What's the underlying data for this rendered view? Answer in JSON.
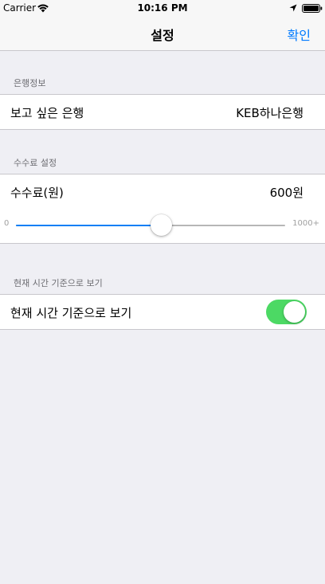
{
  "status_bar": {
    "carrier": "Carrier",
    "time": "10:16 PM",
    "icons": [
      "wifi-icon",
      "location-icon",
      "battery-icon"
    ]
  },
  "nav": {
    "title": "설정",
    "confirm_label": "확인"
  },
  "colors": {
    "accent": "#007aff",
    "slider_fill": "#0f7ff5",
    "toggle_on": "#4cd964",
    "background": "#efeff4"
  },
  "bank_section": {
    "header": "은행정보",
    "row_label": "보고 싶은 은행",
    "row_value": "KEB하나은행"
  },
  "fee_section": {
    "header": "수수료 설정",
    "row_label": "수수료(원)",
    "row_value": "600원",
    "slider": {
      "min_label": "0",
      "max_label": "1000+",
      "value_fraction": 0.54
    }
  },
  "time_section": {
    "header": "현재 시간 기준으로 보기",
    "row_label": "현재 시간 기준으로 보기",
    "toggle_on": true
  }
}
